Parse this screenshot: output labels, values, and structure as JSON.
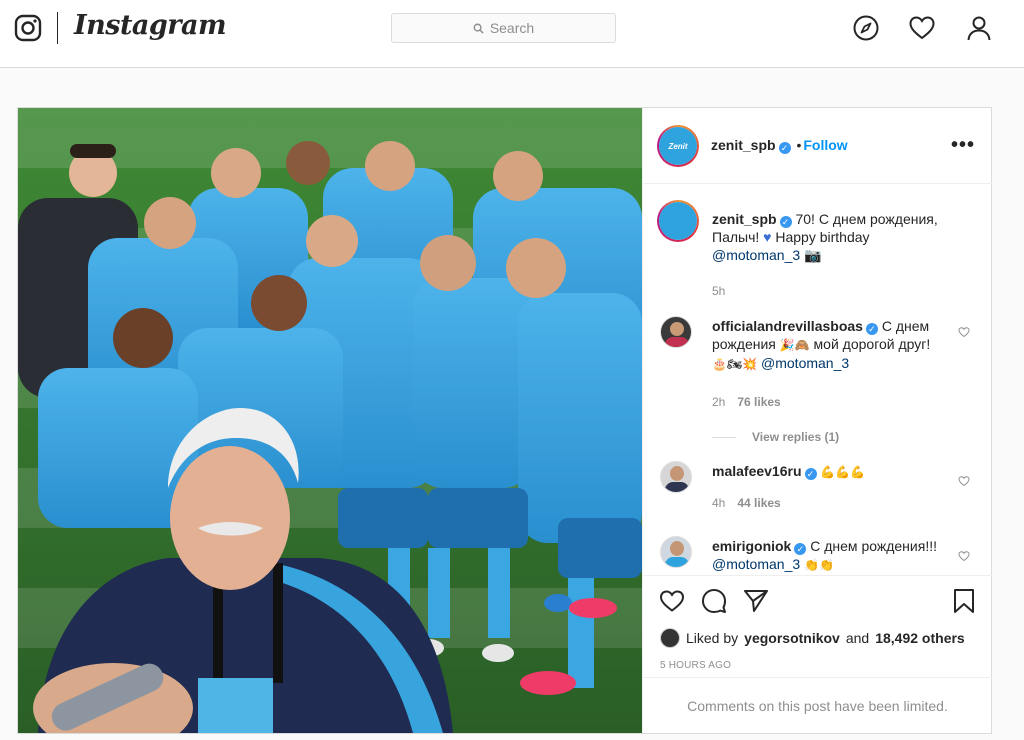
{
  "nav": {
    "wordmark": "Instagram",
    "search_placeholder": "Search",
    "icons": [
      "instagram-camera-icon",
      "compass-icon",
      "heart-icon",
      "profile-icon"
    ]
  },
  "post": {
    "author": "zenit_spb",
    "follow_label": "Follow",
    "more_label": "•••",
    "avatar_text": "Zenit",
    "caption": {
      "username": "zenit_spb",
      "text": "70! С днем рождения, Палыч!",
      "text2": "Happy birthday",
      "mention": "@motoman_3",
      "time": "5h"
    },
    "comments": [
      {
        "username": "officialandrevillasboas",
        "text": "С днем рождения",
        "text2": "мой дорогой друг!",
        "mention": "@motoman_3",
        "time": "2h",
        "likes": "76 likes",
        "view_replies": "View replies (1)"
      },
      {
        "username": "malafeev16ru",
        "text": "",
        "time": "4h",
        "likes": "44 likes"
      },
      {
        "username": "emirigoniok",
        "text": "С днем рождения!!!",
        "mention": "@motoman_3"
      }
    ],
    "liked_by_prefix": "Liked by",
    "liked_by_user": "yegorsotnikov",
    "liked_by_suffix": "and",
    "liked_by_count": "18,492 others",
    "timestamp": "5 HOURS AGO",
    "comments_limited": "Comments on this post have been limited."
  },
  "colors": {
    "accent": "#0095f6",
    "verified": "#3897f0",
    "zenit_blue": "#2fa3de",
    "muted": "#8e8e8e"
  }
}
